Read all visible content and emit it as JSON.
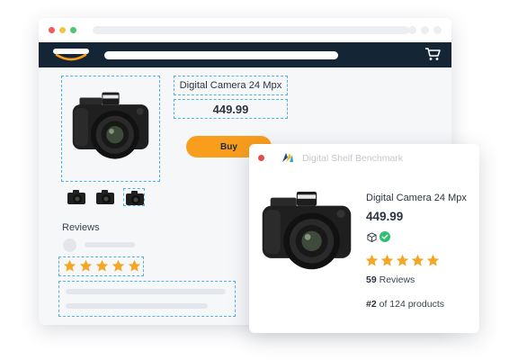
{
  "browser": {
    "icons": {
      "logo": "smile-logo-icon",
      "cart": "cart-icon"
    }
  },
  "product": {
    "title": "Digital Camera 24 Mpx",
    "price": "449.99",
    "buy_label": "Buy",
    "reviews_label": "Reviews",
    "rating": 5,
    "thumbnail_count": 3
  },
  "panel": {
    "title": "Digital Shelf Benchmark",
    "product_name": "Digital Camera 24 Mpx",
    "price": "449.99",
    "rating": 5,
    "reviews_count": "59",
    "reviews_label": "Reviews",
    "rank": "#2",
    "rank_suffix": "of 124 products",
    "icons": {
      "box": "box-icon",
      "check": "check-icon"
    }
  },
  "colors": {
    "navbar": "#142536",
    "accent_orange": "#f99d1c",
    "star": "#f5a623",
    "dashed_outline": "#4fb3e3",
    "check_green": "#2fbf71"
  }
}
